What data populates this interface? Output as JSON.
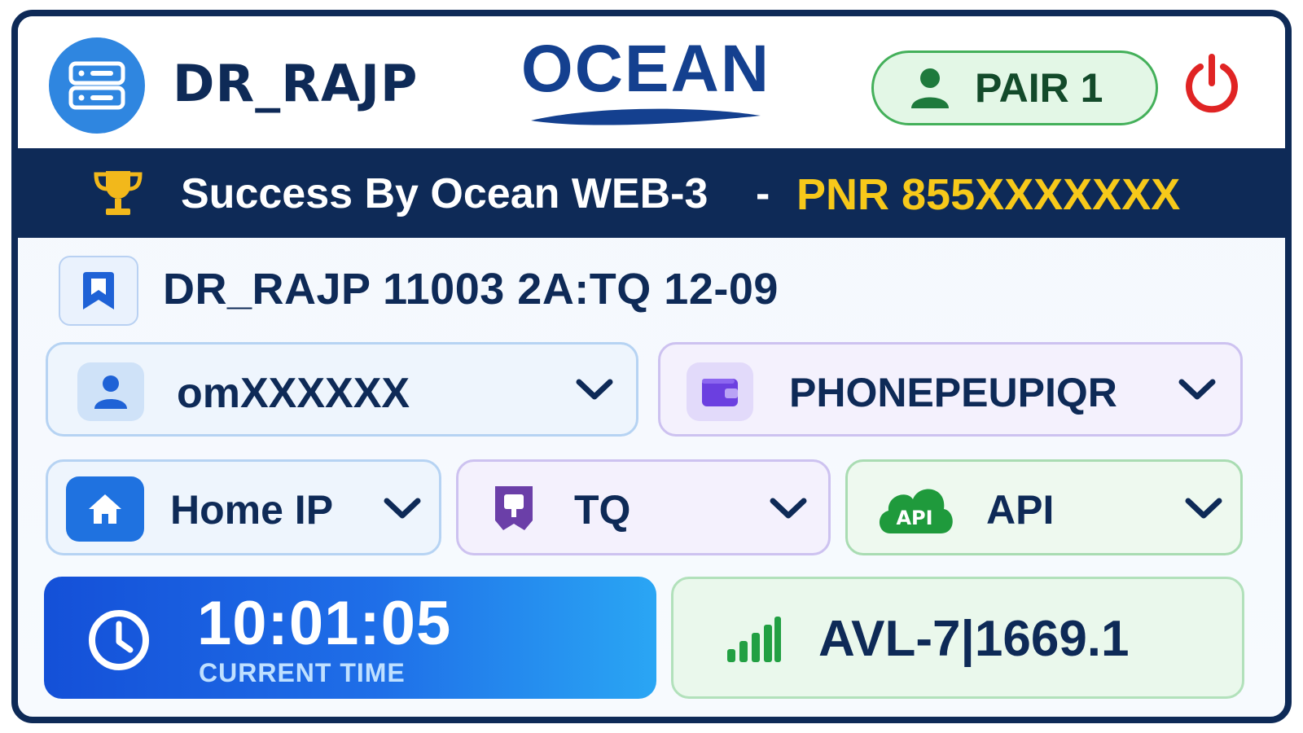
{
  "header": {
    "username": "DR_RAJP",
    "brand": "OCEAN",
    "pair_label": "PAIR 1",
    "icons": {
      "server": "server-icon",
      "user": "user-icon",
      "power": "power-icon"
    }
  },
  "banner": {
    "message": "Success By Ocean WEB-3",
    "separator": "-",
    "pnr": "PNR 855XXXXXXX",
    "icon": "trophy-icon"
  },
  "booking": {
    "summary": "DR_RAJP 11003  2A:TQ 12-09",
    "icon": "bookmark-icon"
  },
  "dropdowns": {
    "account": {
      "value": "omXXXXXX",
      "icon": "user-icon"
    },
    "payment": {
      "value": "PHONEPEUPIQR",
      "icon": "wallet-icon"
    },
    "network": {
      "value": "Home IP",
      "icon": "home-icon"
    },
    "quota": {
      "value": "TQ",
      "icon": "ticket-icon"
    },
    "mode": {
      "value": "API",
      "badge": "API",
      "icon": "cloud-api-icon"
    }
  },
  "clock": {
    "time": "10:01:05",
    "caption": "CURRENT TIME"
  },
  "availability": {
    "value": "AVL-7|1669.1",
    "icon": "signal-icon"
  },
  "colors": {
    "navy": "#0e2a57",
    "brand_blue": "#14408f",
    "pnr_yellow": "#f7c91a",
    "pair_green": "#44b05a",
    "power_red": "#e02424"
  }
}
